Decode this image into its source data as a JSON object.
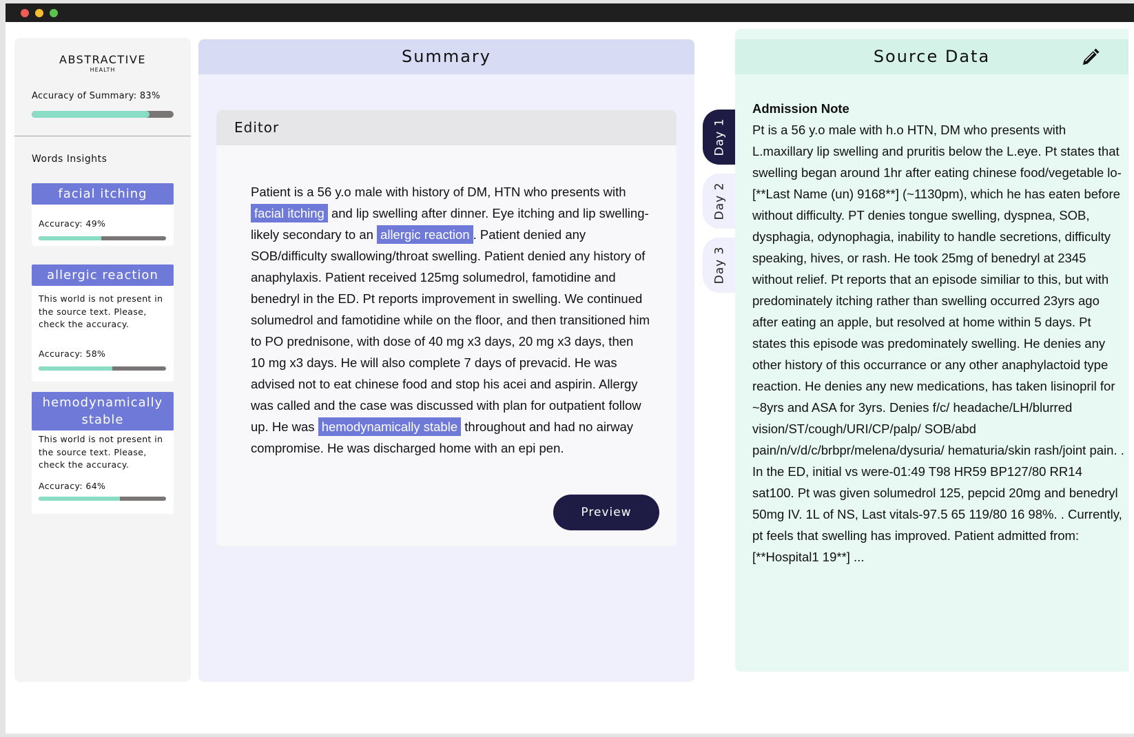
{
  "brand": {
    "name": "ABSTRACTIVE",
    "sub": "HEALTH"
  },
  "summary_accuracy": {
    "label": "Accuracy of Summary: 83%",
    "value": 0.83
  },
  "words_insights_label": "Words Insights",
  "insights": [
    {
      "word": "facial itching",
      "note": "",
      "accuracy_label": "Accuracy: 49%",
      "accuracy": 0.49
    },
    {
      "word": "allergic reaction",
      "note": "This world is not present in the source text.  Please, check the accuracy.",
      "accuracy_label": "Accuracy: 58%",
      "accuracy": 0.58
    },
    {
      "word": "hemodynamically stable",
      "note": "This world is not present in the source text.  Please, check the accuracy.",
      "accuracy_label": "Accuracy: 64%",
      "accuracy": 0.64
    }
  ],
  "summary_title": "Summary",
  "editor": {
    "title": "Editor",
    "text": {
      "p1": "Patient is a 56 y.o male with history of DM, HTN who presents with ",
      "h1": "facial itching",
      "p2": " and lip swelling after dinner. Eye itching and lip swelling-likely secondary to an ",
      "h2": "allergic reaction",
      "p3": ". Patient denied any SOB/difficulty swallowing/throat swelling. Patient denied any history of anaphylaxis. Patient received 125mg solumedrol, famotidine and benedryl in the ED. Pt reports improvement in swelling.  We continued solumedrol and famotidine while on the floor, and then transitioned him to PO prednisone, with dose of 40 mg x3 days, 20 mg x3 days, then 10 mg x3 days.  He will also complete 7 days of prevacid.  He was advised not to eat chinese food and stop his acei and aspirin.  Allergy was called and the case was discussed with plan for outpatient follow up.  He was ",
      "h3": "hemodynamically stable",
      "p4": " throughout and had no airway compromise. He was discharged home with an epi pen."
    },
    "preview_label": "Preview"
  },
  "day_tabs": [
    "Day 1",
    "Day 2",
    "Day 3"
  ],
  "active_day": "Day 1",
  "source": {
    "title": "Source Data",
    "edit_icon": "pencil-icon",
    "note_title": "Admission Note",
    "note_text": "Pt is a 56 y.o male with h.o HTN, DM who presents with L.maxillary lip swelling and pruritis below the L.eye. Pt states that swelling began around 1hr after eating chinese food/vegetable lo-[**Last Name (un) 9168**] (~1130pm), which he has eaten before without difficulty. PT denies tongue swelling, dyspnea, SOB, dysphagia, odynophagia, inability to handle secretions, difficulty speaking, hives, or rash. He took 25mg of benedryl at 2345 without relief. Pt reports that an episode similiar to this, but with predominately itching rather than swelling occurred 23yrs ago after eating an apple, but resolved at home within 5 days. Pt states this episode was predominately swelling. He denies any other history of this occurrance or any other anaphylactoid type reaction. He denies any new medications, has taken lisinopril for ~8yrs and ASA for 3yrs. Denies f/c/ headache/LH/blurred vision/ST/cough/URI/CP/palp/ SOB/abd pain/n/v/d/c/brbpr/melena/dysuria/ hematuria/skin rash/joint pain. . In the ED, initial vs were-01:49 T98 HR59 BP127/80 RR14 sat100. Pt was given solumedrol 125, pepcid 20mg and benedryl 50mg IV. 1L of NS, Last vitals-97.5 65 119/80 16 98%. . Currently, pt feels that swelling has improved. Patient admitted from: [**Hospital1 19**] ..."
  },
  "colors": {
    "highlight": "#6f79d7",
    "accuracy_fill": "#8bdcc4",
    "dark_navy": "#1e1b45",
    "summary_bg": "#eff0fb",
    "source_bg": "#e8f8f2"
  }
}
